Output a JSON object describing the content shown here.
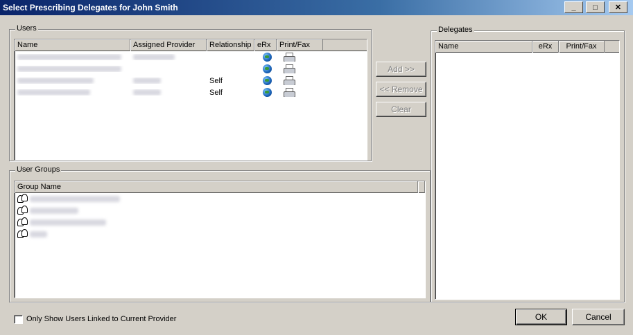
{
  "window": {
    "title": "Select Prescribing Delegates for John  Smith",
    "minimize": "_",
    "maximize": "□",
    "close": "✕"
  },
  "users_group": {
    "label": "Users",
    "columns": [
      "Name",
      "Assigned Provider",
      "Relationship",
      "eRx",
      "Print/Fax"
    ],
    "rows": [
      {
        "relationship": "",
        "erx_icon": "globe-icon",
        "print_icon": "printer-icon"
      },
      {
        "relationship": "",
        "erx_icon": "globe-icon",
        "print_icon": "printer-icon"
      },
      {
        "relationship": "Self",
        "erx_icon": "globe-icon",
        "print_icon": "printer-icon"
      },
      {
        "relationship": "Self",
        "erx_icon": "globe-icon",
        "print_icon": "printer-icon"
      }
    ]
  },
  "user_groups": {
    "label": "User Groups",
    "columns": [
      "Group Name"
    ],
    "row_icon": "user-group-icon",
    "row_count": 4
  },
  "actions": {
    "add": "Add >>",
    "remove": "<< Remove",
    "clear": "Clear"
  },
  "delegates_group": {
    "label": "Delegates",
    "columns": [
      "Name",
      "eRx",
      "Print/Fax"
    ]
  },
  "filter": {
    "checkbox_label": "Only Show Users Linked to Current Provider",
    "checked": false
  },
  "footer": {
    "ok": "OK",
    "cancel": "Cancel"
  }
}
